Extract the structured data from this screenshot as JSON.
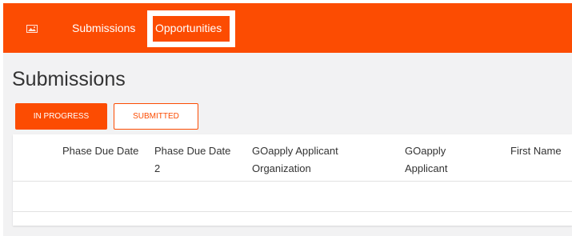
{
  "header": {
    "logo_icon": "image-icon",
    "nav": [
      {
        "label": "Submissions"
      },
      {
        "label": "Opportunities"
      }
    ],
    "brand_color": "#fc4c02"
  },
  "main": {
    "title": "Submissions",
    "tabs": [
      {
        "label": "IN PROGRESS",
        "active": true
      },
      {
        "label": "SUBMITTED",
        "active": false
      }
    ],
    "table": {
      "columns": [
        "Phase Due Date",
        "Phase Due Date 2",
        "GOapply Applicant Organization",
        "GOapply Applicant",
        "First Name"
      ],
      "rows": []
    }
  }
}
